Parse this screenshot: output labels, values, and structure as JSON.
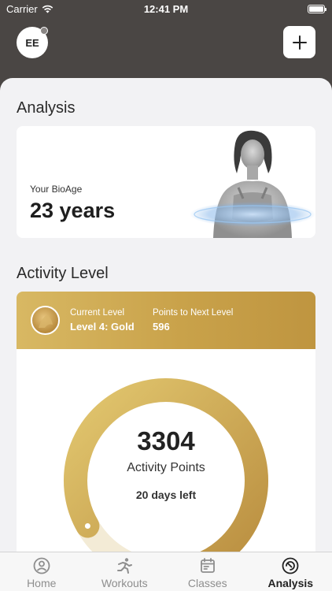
{
  "status_bar": {
    "carrier": "Carrier",
    "time": "12:41 PM"
  },
  "header": {
    "avatar_initials": "EE"
  },
  "analysis": {
    "title": "Analysis",
    "bioage_label": "Your BioAge",
    "bioage_value": "23 years"
  },
  "activity": {
    "title": "Activity Level",
    "current_level_label": "Current Level",
    "current_level_value": "Level 4: Gold",
    "points_next_label": "Points to Next Level",
    "points_next_value": "596",
    "points": "3304",
    "points_caption": "Activity Points",
    "days_left": "20 days left",
    "progress_fraction": 0.85
  },
  "tabs": [
    {
      "label": "Home",
      "icon": "home-person-icon"
    },
    {
      "label": "Workouts",
      "icon": "running-figure-icon"
    },
    {
      "label": "Classes",
      "icon": "calendar-icon"
    },
    {
      "label": "Analysis",
      "icon": "analysis-gauge-icon"
    }
  ],
  "colors": {
    "header_bg": "#4a4644",
    "gold_light": "#e0c56e",
    "gold_dark": "#b98d3f",
    "track": "#f3ebd6"
  }
}
